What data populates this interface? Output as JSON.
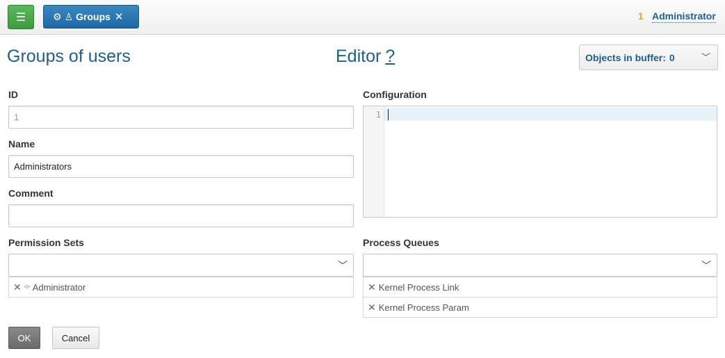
{
  "header": {
    "menu_icon": "hamburger-icon",
    "tab": {
      "gear_icon": "⚙",
      "user_icon": "♙",
      "label": "Groups",
      "close_icon": "✕"
    },
    "user": {
      "count": "1",
      "name": "Administrator"
    }
  },
  "titles": {
    "page": "Groups of users",
    "editor": "Editor",
    "help": "?"
  },
  "buffer": {
    "label": "Objects in buffer:",
    "count": "0"
  },
  "form": {
    "id": {
      "label": "ID",
      "value": "1"
    },
    "name": {
      "label": "Name",
      "value": "Administrators"
    },
    "comment": {
      "label": "Comment",
      "value": ""
    },
    "configuration": {
      "label": "Configuration",
      "line_number": "1"
    },
    "permission_sets": {
      "label": "Permission Sets",
      "items": [
        "Administrator"
      ]
    },
    "process_queues": {
      "label": "Process Queues",
      "items": [
        "Kernel Process Link",
        "Kernel Process Param"
      ]
    }
  },
  "actions": {
    "ok": "OK",
    "cancel": "Cancel"
  },
  "colors": {
    "accent": "#1e5e8e",
    "menu_green": "#4cae4c",
    "tab_blue": "#2a78b4",
    "user_count": "#f0a020"
  }
}
